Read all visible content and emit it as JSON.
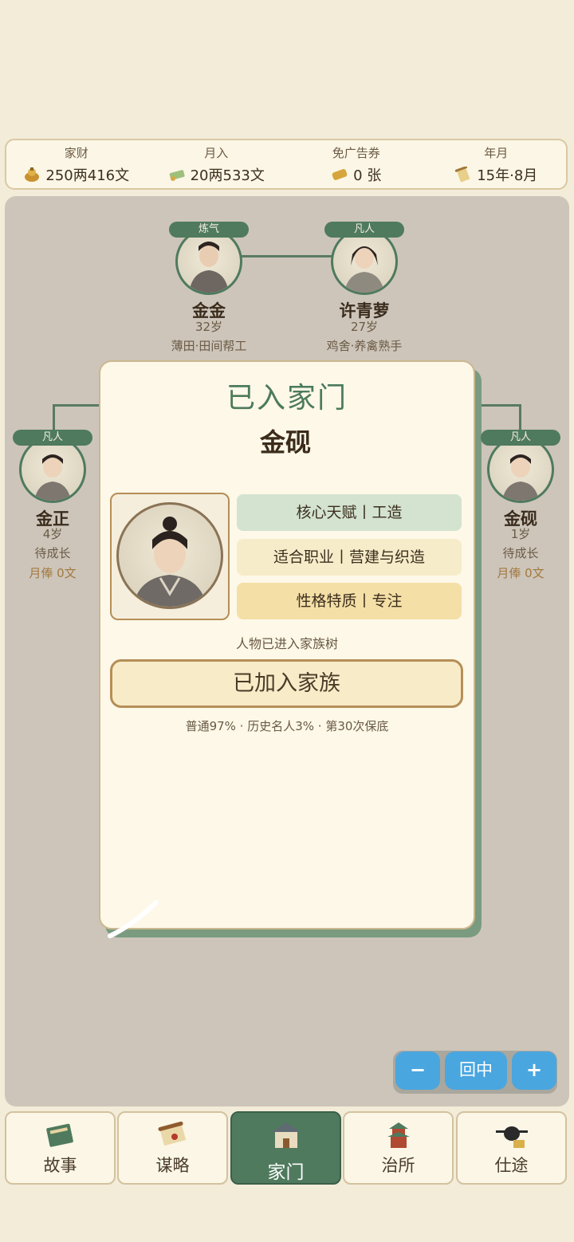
{
  "stats": [
    {
      "label": "家财",
      "value": "250两416文",
      "icon": "coin-bag-icon"
    },
    {
      "label": "月入",
      "value": "20两533文",
      "icon": "money-bundle-icon"
    },
    {
      "label": "免广告券",
      "value": "0 张",
      "icon": "ticket-icon"
    },
    {
      "label": "年月",
      "value": "15年·8月",
      "icon": "scroll-icon"
    }
  ],
  "tree": {
    "father": {
      "rank": "炼气",
      "name": "金金",
      "age": "32岁",
      "job": "薄田·田间帮工"
    },
    "mother": {
      "rank": "凡人",
      "name": "许青萝",
      "age": "27岁",
      "job": "鸡舍·养禽熟手"
    },
    "child_left": {
      "rank": "凡人",
      "name": "金正",
      "age": "4岁",
      "status": "待成长",
      "wage": "月俸 0文"
    },
    "child_right": {
      "rank": "凡人",
      "name": "金砚",
      "age": "1岁",
      "status": "待成长",
      "wage": "月俸 0文"
    }
  },
  "modal": {
    "title": "已入家门",
    "name": "金砚",
    "traits": [
      "核心天赋丨工造",
      "适合职业丨营建与织造",
      "性格特质丨专注"
    ],
    "hint": "人物已进入家族树",
    "button": "已加入家族",
    "odds": "普通97% · 历史名人3% · 第30次保底"
  },
  "zoom": {
    "minus": "−",
    "center": "回中",
    "plus": "+"
  },
  "nav": [
    {
      "label": "故事",
      "icon": "book-icon",
      "active": false
    },
    {
      "label": "谋略",
      "icon": "scroll-strategy-icon",
      "active": false
    },
    {
      "label": "家门",
      "icon": "house-icon",
      "active": true
    },
    {
      "label": "治所",
      "icon": "pagoda-icon",
      "active": false
    },
    {
      "label": "仕途",
      "icon": "official-hat-icon",
      "active": false
    }
  ],
  "colors": {
    "accent": "#4f7a5e",
    "zoom": "#4aa6df",
    "paper": "#fdf8e8"
  }
}
